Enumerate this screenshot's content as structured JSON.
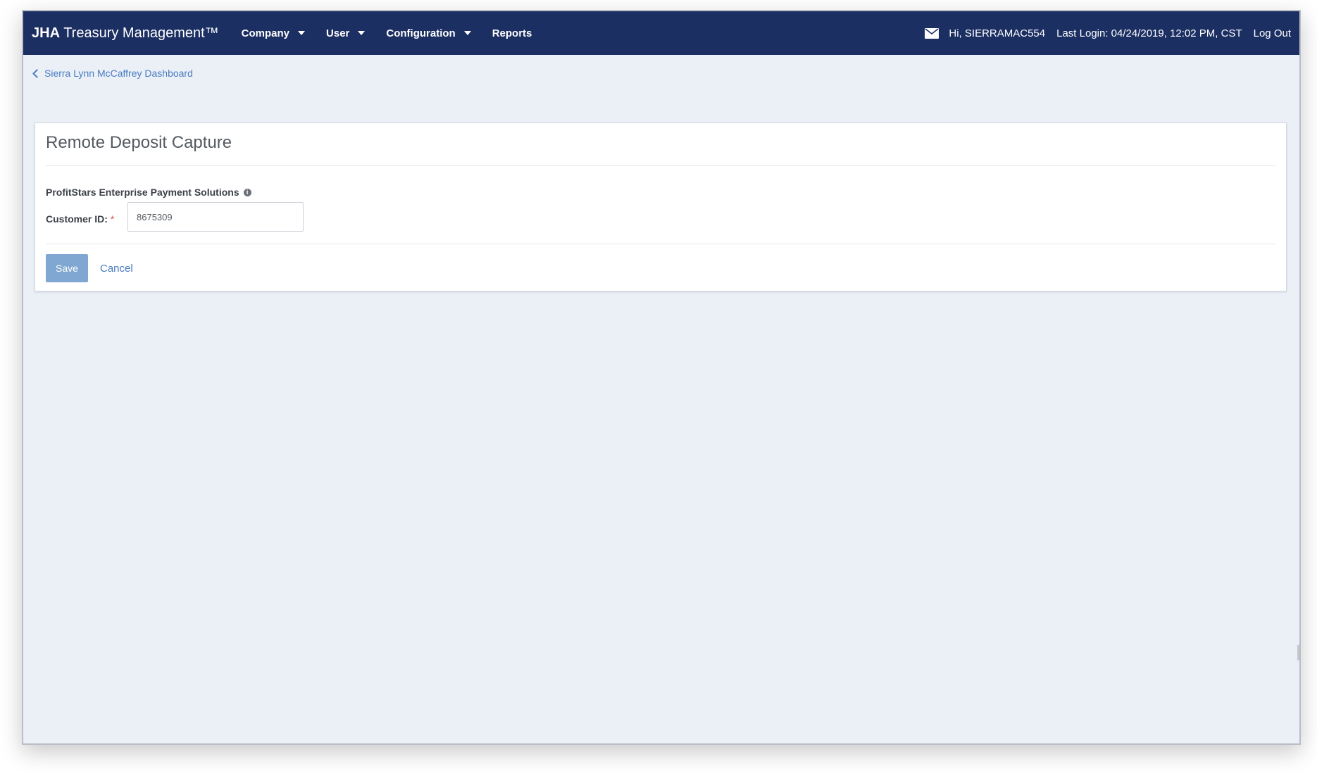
{
  "header": {
    "brand_strong": "JHA",
    "brand_rest": " Treasury Management™",
    "menu": [
      {
        "label": "Company",
        "has_dropdown": true
      },
      {
        "label": "User",
        "has_dropdown": true
      },
      {
        "label": "Configuration",
        "has_dropdown": true
      },
      {
        "label": "Reports",
        "has_dropdown": false
      }
    ],
    "greeting": "Hi, SIERRAMAC554",
    "last_login": "Last Login: 04/24/2019, 12:02 PM, CST",
    "logout_label": "Log Out",
    "mail_icon": "envelope-icon",
    "bg_color": "#1c2f63"
  },
  "breadcrumb": {
    "label": "Sierra Lynn McCaffrey Dashboard",
    "icon": "chevron-left-icon"
  },
  "panel": {
    "title": "Remote Deposit Capture",
    "section_label": "ProfitStars Enterprise Payment Solutions",
    "info_icon": "info-icon",
    "customer_id_label": "Customer ID:",
    "required_marker": "*",
    "customer_id_value": "8675309",
    "save_label": "Save",
    "cancel_label": "Cancel"
  },
  "colors": {
    "page_bg": "#ebf0f7",
    "link": "#4a7cc0",
    "save_button": "#7fa7d1"
  }
}
